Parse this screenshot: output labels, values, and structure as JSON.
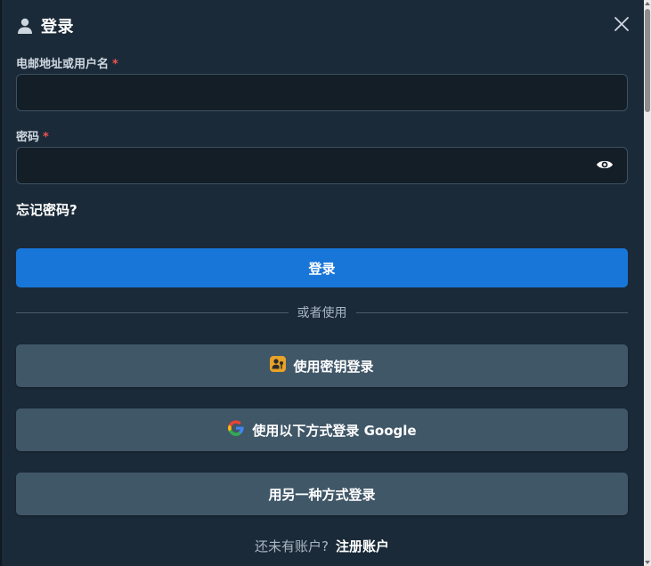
{
  "dialog": {
    "title": "登录",
    "icons": {
      "title": "user-icon",
      "close": "close-icon"
    }
  },
  "form": {
    "email_label": "电邮地址或用户名",
    "email_required": "*",
    "email_value": "",
    "email_placeholder": "",
    "password_label": "密码",
    "password_required": "*",
    "password_value": "",
    "password_placeholder": "",
    "show_password_icon": "eye-icon",
    "forgot_password": "忘记密码?"
  },
  "buttons": {
    "login": "登录",
    "divider": "或者使用",
    "passkey": "使用密钥登录",
    "passkey_icon": "passkey-icon",
    "google": "使用以下方式登录 Google",
    "google_icon": "google-icon",
    "other": "用另一种方式登录"
  },
  "footer": {
    "prompt": "还未有账户?",
    "register": "注册账户"
  },
  "colors": {
    "background": "#1b2a38",
    "primary": "#1976d9",
    "secondary": "#405768",
    "input_bg": "#131e27",
    "required": "#ef5350"
  }
}
